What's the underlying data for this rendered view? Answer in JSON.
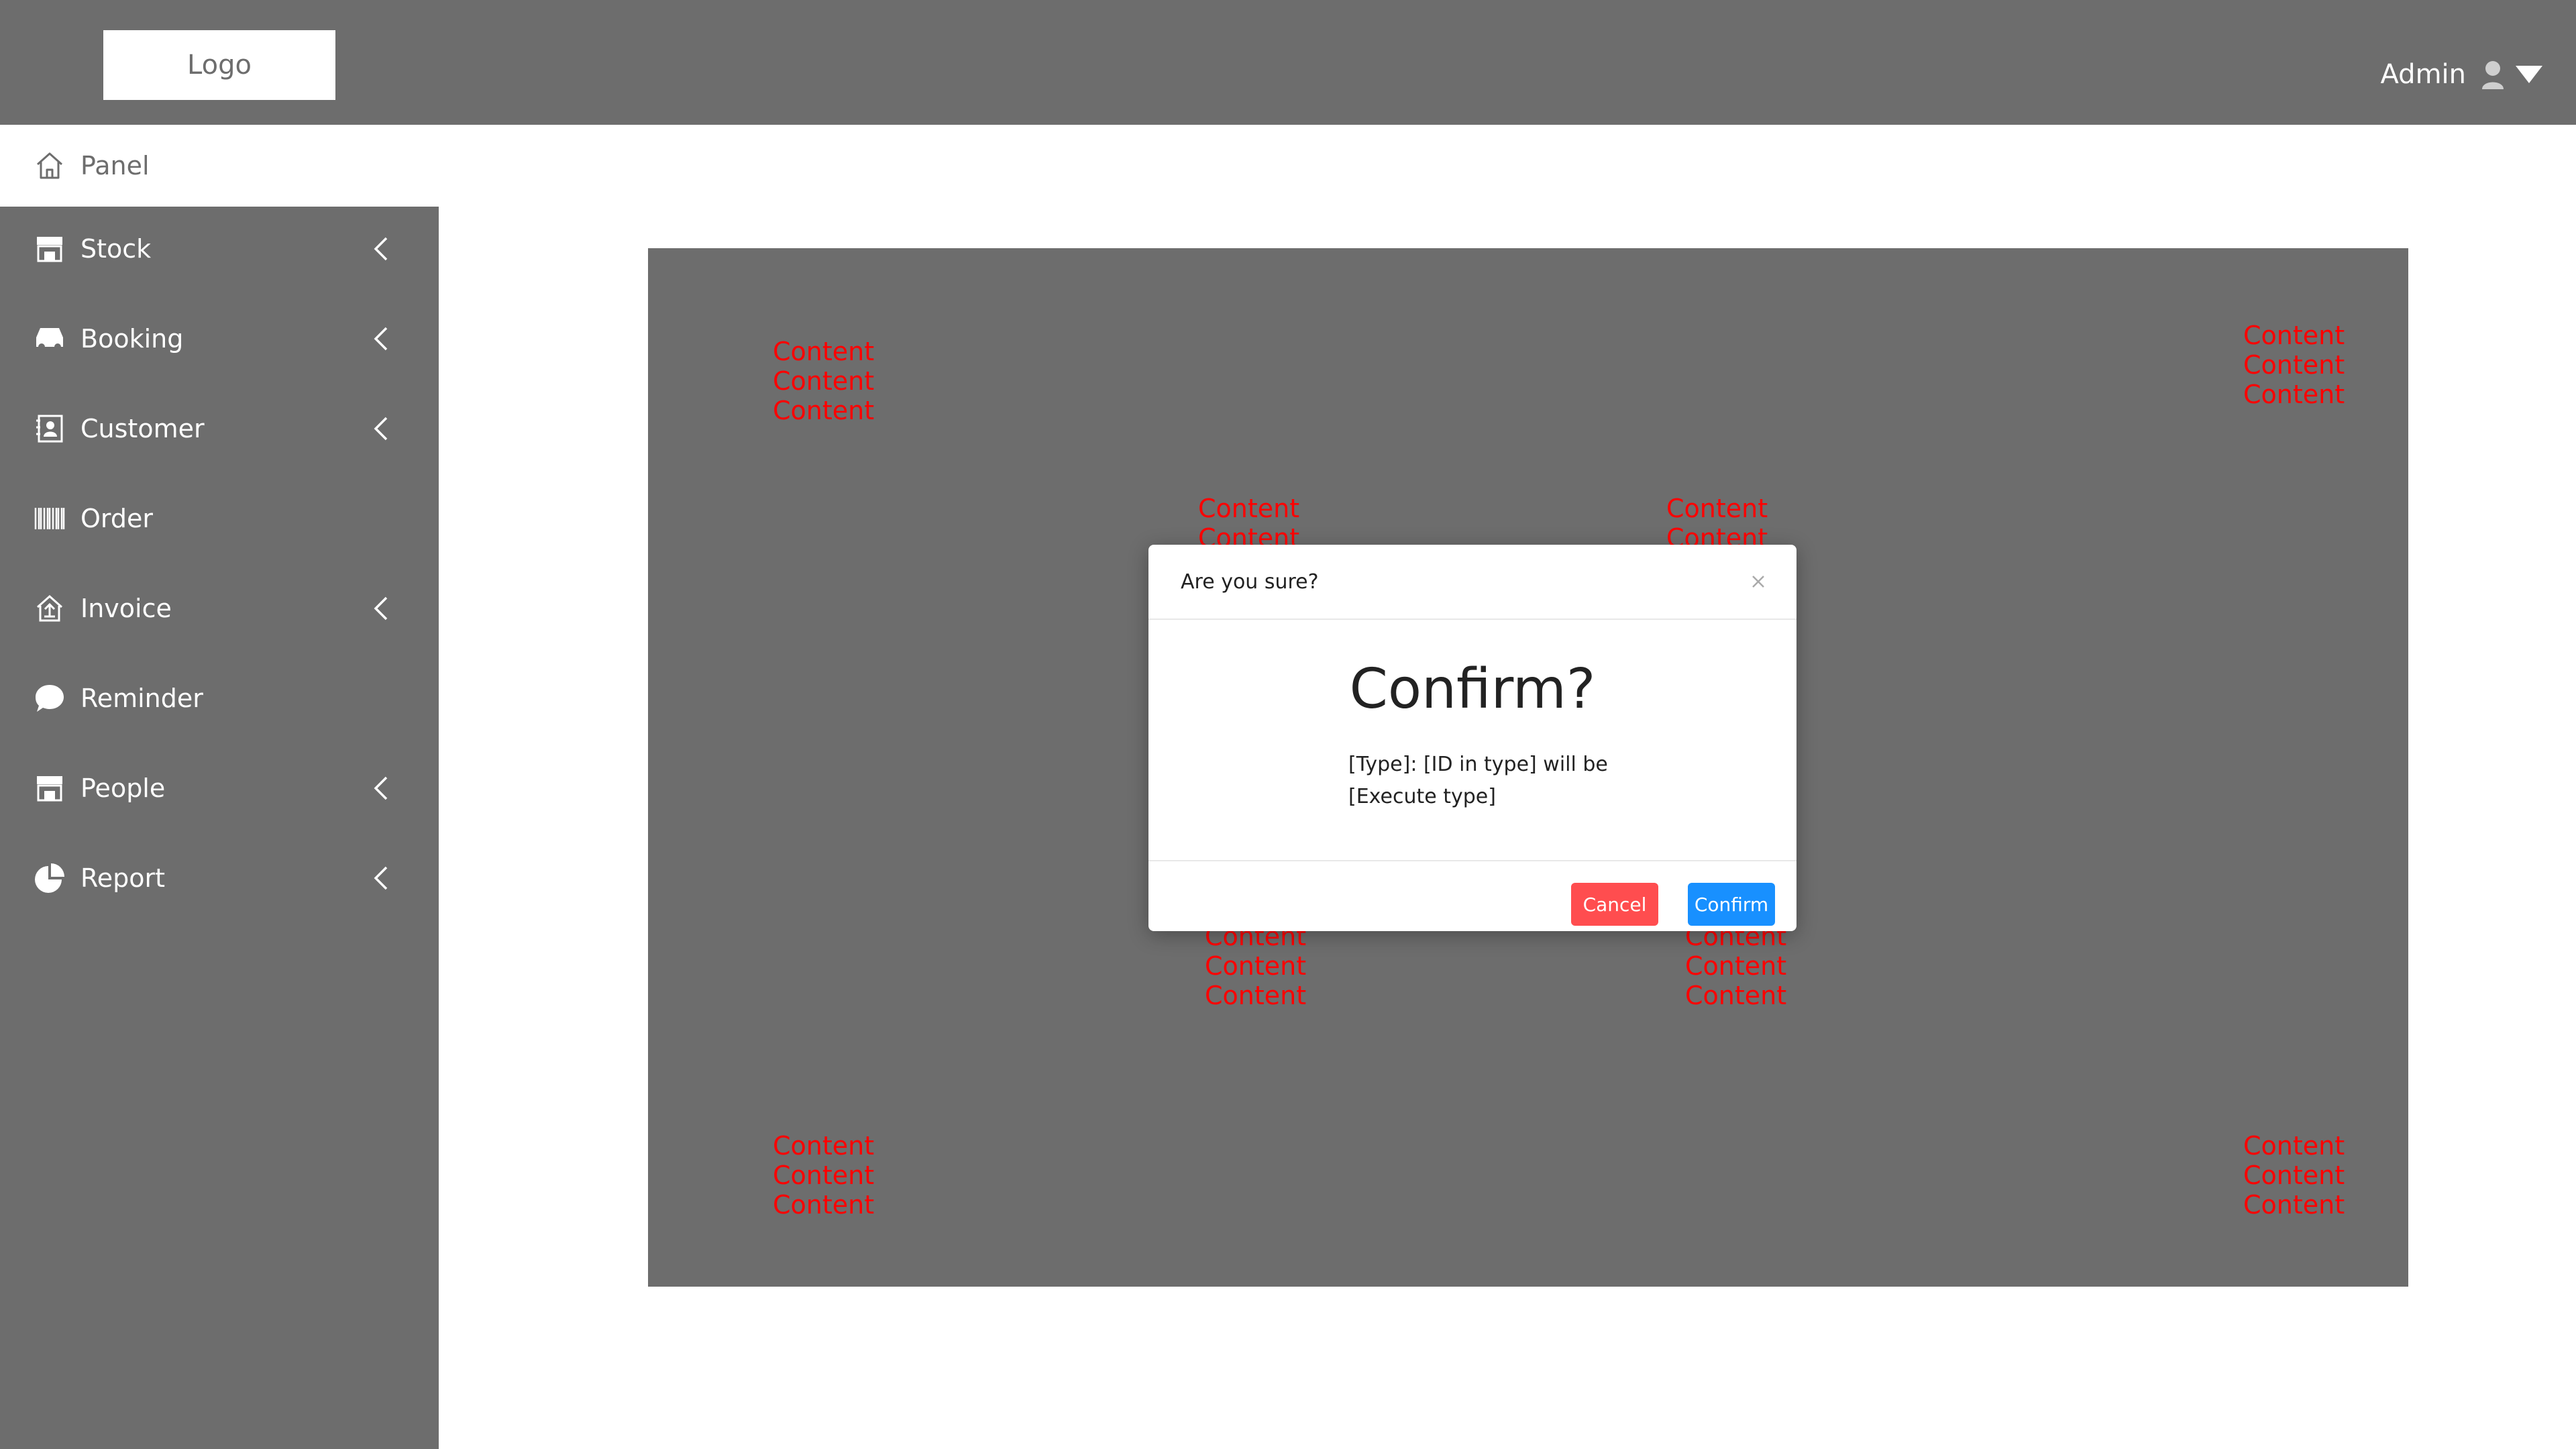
{
  "header": {
    "logo": "Logo",
    "user_name": "Admin",
    "user_icon": "user-icon",
    "dropdown_icon": "caret-down-icon"
  },
  "sidebar": {
    "panel": {
      "label": "Panel",
      "icon": "home-icon"
    },
    "items": [
      {
        "label": "Stock",
        "icon": "store-icon",
        "expandable": true
      },
      {
        "label": "Booking",
        "icon": "car-icon",
        "expandable": true
      },
      {
        "label": "Customer",
        "icon": "contact-card-icon",
        "expandable": true
      },
      {
        "label": "Order",
        "icon": "barcode-icon",
        "expandable": false
      },
      {
        "label": "Invoice",
        "icon": "invoice-icon",
        "expandable": true
      },
      {
        "label": "Reminder",
        "icon": "chat-bubble-icon",
        "expandable": false
      },
      {
        "label": "People",
        "icon": "store-icon",
        "expandable": true
      },
      {
        "label": "Report",
        "icon": "pie-chart-icon",
        "expandable": true
      }
    ]
  },
  "main": {
    "content_top_left": [
      "Content",
      "Content",
      "Content"
    ],
    "content_top_right": [
      "Content",
      "Content",
      "Content"
    ],
    "content_mid_left": [
      "Content",
      "Content"
    ],
    "content_mid_right": [
      "Content",
      "Content"
    ],
    "content_low_left": [
      "Content",
      "Content",
      "Content"
    ],
    "content_low_right": [
      "Content",
      "Content",
      "Content"
    ],
    "content_bottom_left": [
      "Content",
      "Content",
      "Content"
    ],
    "content_bottom_right": [
      "Content",
      "Content",
      "Content"
    ]
  },
  "modal": {
    "title": "Are you sure?",
    "heading": "Confirm?",
    "message_line1": "[Type]: [ID in type] will be",
    "message_line2": "[Execute type]",
    "cancel_label": "Cancel",
    "confirm_label": "Confirm"
  },
  "colors": {
    "chrome": "#6d6d6d",
    "content_text": "#ff0000",
    "cancel": "#ff4d4f",
    "confirm": "#1890ff"
  }
}
